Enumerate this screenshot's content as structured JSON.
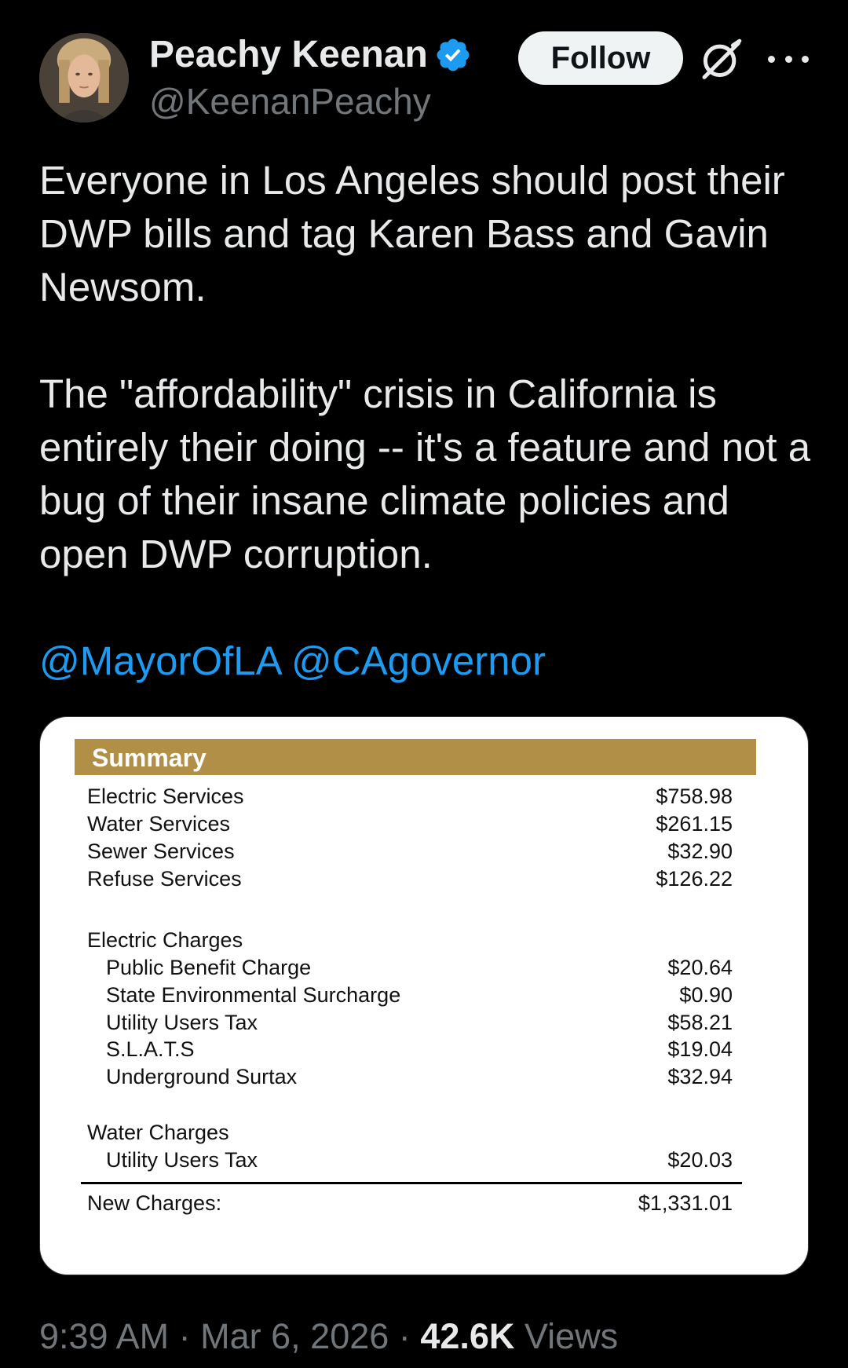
{
  "author": {
    "display_name": "Peachy Keenan",
    "handle": "@KeenanPeachy",
    "verified_icon": "verified-badge-icon",
    "verified_color": "#1d9bf0"
  },
  "actions": {
    "follow_label": "Follow",
    "grok_icon": "grok-icon",
    "more_icon": "more-options-icon"
  },
  "tweet": {
    "paragraph_1": "Everyone in Los Angeles should post their DWP bills and tag Karen Bass and Gavin Newsom.",
    "paragraph_2": "The \"affordability\" crisis in California is entirely their doing -- it's a feature and not a bug of their insane climate policies and open DWP corruption.",
    "mentions": [
      "@MayorOfLA",
      "@CAgovernor"
    ],
    "mention_color": "#1d9bf0"
  },
  "bill": {
    "header": "Summary",
    "header_color": "#b28f46",
    "services": [
      {
        "label": "Electric Services",
        "amount": "$758.98"
      },
      {
        "label": "Water Services",
        "amount": "$261.15"
      },
      {
        "label": "Sewer Services",
        "amount": "$32.90"
      },
      {
        "label": "Refuse Services",
        "amount": "$126.22"
      }
    ],
    "electric_charges_heading": "Electric Charges",
    "electric_charges": [
      {
        "label": "Public Benefit Charge",
        "amount": "$20.64"
      },
      {
        "label": "State Environmental Surcharge",
        "amount": "$0.90"
      },
      {
        "label": "Utility Users Tax",
        "amount": "$58.21"
      },
      {
        "label": "S.L.A.T.S",
        "amount": "$19.04"
      },
      {
        "label": "Underground Surtax",
        "amount": "$32.94"
      }
    ],
    "water_charges_heading": "Water Charges",
    "water_charges": [
      {
        "label": "Utility Users Tax",
        "amount": "$20.03"
      }
    ],
    "total_label": "New Charges:",
    "total_amount": "$1,331.01"
  },
  "meta": {
    "time": "9:39 AM",
    "separator": "·",
    "date": "Mar 6, 2026",
    "views_count": "42.6K",
    "views_label": "Views"
  }
}
